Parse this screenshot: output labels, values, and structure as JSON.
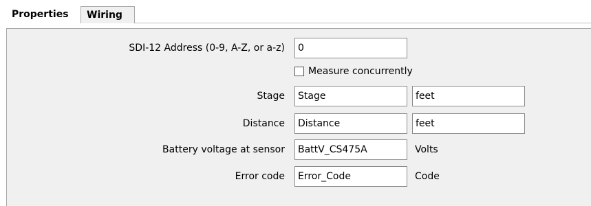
{
  "tabs": [
    {
      "label": "Properties",
      "active": true
    },
    {
      "label": "Wiring",
      "active": false
    }
  ],
  "form": {
    "sdi_address": {
      "label": "SDI-12 Address (0-9, A-Z, or a-z)",
      "value": "0"
    },
    "measure_concurrently": {
      "label": "Measure concurrently",
      "checked": false
    },
    "stage": {
      "label": "Stage",
      "value": "Stage",
      "units": "feet"
    },
    "distance": {
      "label": "Distance",
      "value": "Distance",
      "units": "feet"
    },
    "battery": {
      "label": "Battery voltage at sensor",
      "value": "BattV_CS475A",
      "units": "Volts"
    },
    "error_code": {
      "label": "Error code",
      "value": "Error_Code",
      "units": "Code"
    }
  }
}
